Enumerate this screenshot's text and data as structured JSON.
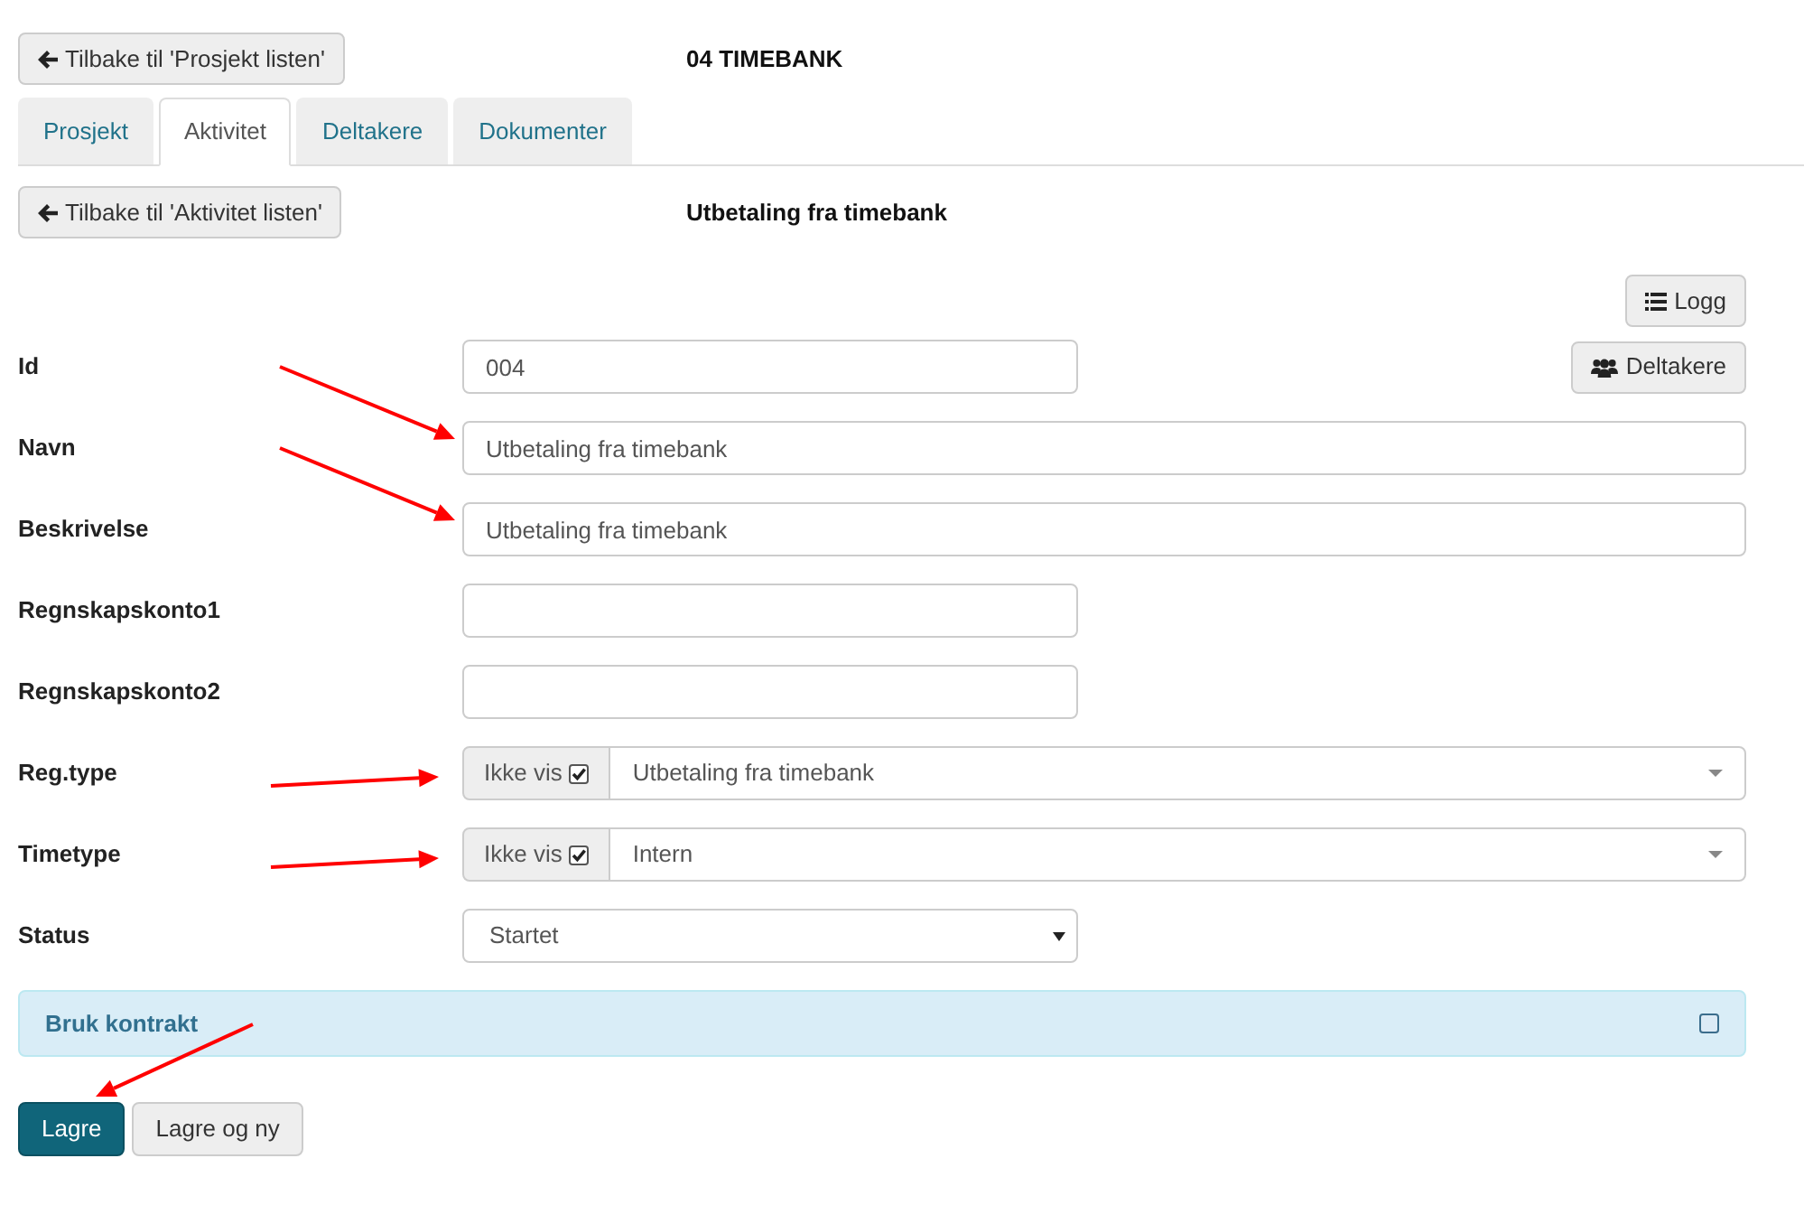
{
  "header": {
    "back_button": "Tilbake til 'Prosjekt listen'",
    "title": "04 TIMEBANK"
  },
  "tabs": [
    {
      "label": "Prosjekt",
      "selected": false
    },
    {
      "label": "Aktivitet",
      "selected": true
    },
    {
      "label": "Deltakere",
      "selected": false
    },
    {
      "label": "Dokumenter",
      "selected": false
    }
  ],
  "activity": {
    "back_button": "Tilbake til 'Aktivitet listen'",
    "title": "Utbetaling fra timebank"
  },
  "toolbar": {
    "log_button": "Logg",
    "participants_button": "Deltakere"
  },
  "fields": [
    {
      "label": "Id",
      "kind": "short_text",
      "value": "004",
      "annotated": false
    },
    {
      "label": "Navn",
      "kind": "long_text",
      "value": "Utbetaling fra timebank",
      "annotated": true
    },
    {
      "label": "Beskrivelse",
      "kind": "long_text",
      "value": "Utbetaling fra timebank",
      "annotated": true
    },
    {
      "label": "Regnskapskonto1",
      "kind": "short_text",
      "annotated": false
    },
    {
      "label": "Regnskapskonto2",
      "kind": "short_text",
      "annotated": false
    },
    {
      "label": "Reg.type",
      "kind": "choice",
      "addon": "Ikke vis",
      "checked": true,
      "value": "Utbetaling fra timebank",
      "annotated": true
    },
    {
      "label": "Timetype",
      "kind": "choice",
      "addon": "Ikke vis",
      "checked": true,
      "value": "Intern",
      "annotated": true
    },
    {
      "label": "Status",
      "kind": "dropdown",
      "value": "Startet",
      "annotated": false
    }
  ],
  "contract_panel": {
    "title": "Bruk kontrakt",
    "checked": false
  },
  "buttons": [
    {
      "label": "Lagre",
      "kind": "primary",
      "annotated": true
    },
    {
      "label": "Lagre og ny",
      "kind": "default",
      "annotated": false
    }
  ]
}
